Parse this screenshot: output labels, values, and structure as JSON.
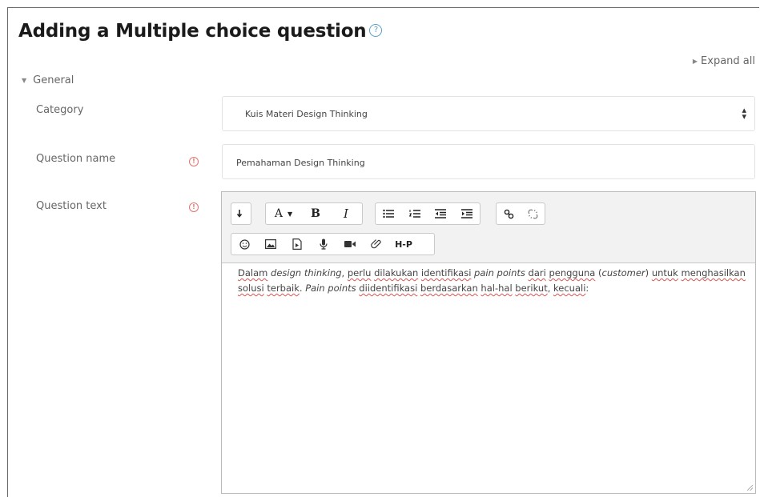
{
  "page": {
    "title": "Adding a Multiple choice question",
    "expand_all": "Expand all"
  },
  "section": {
    "label": "General"
  },
  "fields": {
    "category": {
      "label": "Category",
      "value": "Kuis Materi Design Thinking"
    },
    "question_name": {
      "label": "Question name",
      "value": "Pemahaman Design Thinking"
    },
    "question_text": {
      "label": "Question text"
    }
  },
  "toolbar": {
    "h5p_label": "H-P"
  },
  "editor": {
    "segments": [
      {
        "text": "Dalam",
        "style": "spell"
      },
      {
        "text": " ",
        "style": "normal"
      },
      {
        "text": "design thinking",
        "style": "italic"
      },
      {
        "text": ", ",
        "style": "normal"
      },
      {
        "text": "perlu",
        "style": "spell"
      },
      {
        "text": " ",
        "style": "normal"
      },
      {
        "text": "dilakukan",
        "style": "spell"
      },
      {
        "text": " ",
        "style": "normal"
      },
      {
        "text": "identifikasi",
        "style": "spell"
      },
      {
        "text": " ",
        "style": "normal"
      },
      {
        "text": "pain points",
        "style": "italic"
      },
      {
        "text": " ",
        "style": "normal"
      },
      {
        "text": "dari",
        "style": "spell"
      },
      {
        "text": " ",
        "style": "normal"
      },
      {
        "text": "pengguna",
        "style": "spell"
      },
      {
        "text": " (",
        "style": "normal"
      },
      {
        "text": "customer",
        "style": "italic"
      },
      {
        "text": ") ",
        "style": "normal"
      },
      {
        "text": "untuk",
        "style": "spell"
      },
      {
        "text": " ",
        "style": "normal"
      },
      {
        "text": "menghasilkan",
        "style": "spell"
      },
      {
        "text": " ",
        "style": "normal"
      },
      {
        "text": "solusi",
        "style": "spell"
      },
      {
        "text": " ",
        "style": "normal"
      },
      {
        "text": "terbaik",
        "style": "spell"
      },
      {
        "text": ". ",
        "style": "normal"
      },
      {
        "text": "Pain points",
        "style": "italic"
      },
      {
        "text": " ",
        "style": "normal"
      },
      {
        "text": "diidentifikasi",
        "style": "spell"
      },
      {
        "text": " ",
        "style": "normal"
      },
      {
        "text": "berdasarkan",
        "style": "spell"
      },
      {
        "text": " ",
        "style": "normal"
      },
      {
        "text": "hal-hal",
        "style": "spell"
      },
      {
        "text": " ",
        "style": "normal"
      },
      {
        "text": "berikut",
        "style": "spell"
      },
      {
        "text": ", ",
        "style": "normal"
      },
      {
        "text": "kecuali",
        "style": "spell"
      },
      {
        "text": ":",
        "style": "normal"
      }
    ]
  },
  "colors": {
    "required": "#e5746f",
    "help": "#5a9ec9",
    "spellcheck": "#d9534f"
  }
}
